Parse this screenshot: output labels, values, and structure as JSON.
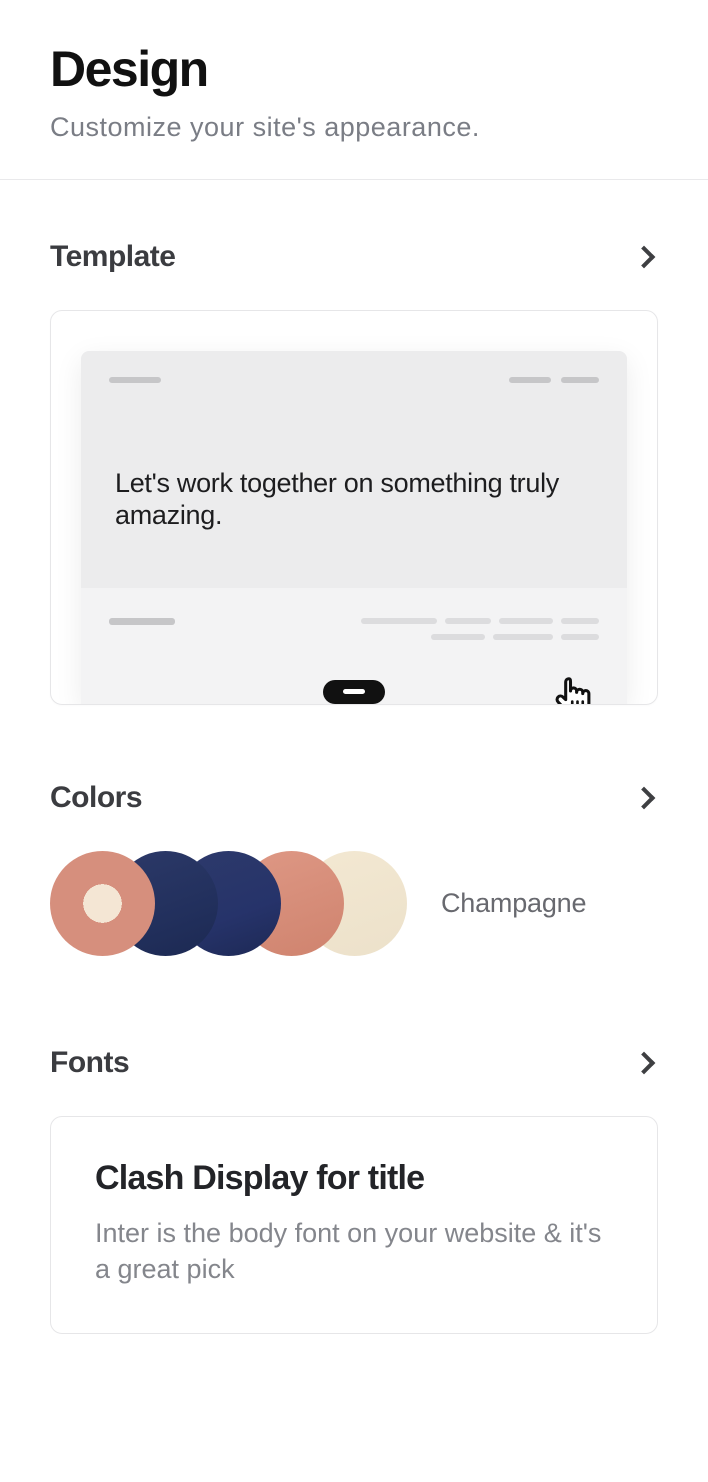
{
  "header": {
    "title": "Design",
    "subtitle": "Customize your site's appearance."
  },
  "sections": {
    "template": {
      "label": "Template",
      "preview_heading": "Let's work together on something truly amazing."
    },
    "colors": {
      "label": "Colors",
      "palette_name": "Champagne",
      "swatches": [
        "#d68f7d",
        "#26336a",
        "#26336a",
        "#d68f7d",
        "#efe3cd"
      ]
    },
    "fonts": {
      "label": "Fonts",
      "title_preview": "Clash Display for title",
      "body_preview": "Inter is the body font on your website & it's a great pick"
    }
  }
}
